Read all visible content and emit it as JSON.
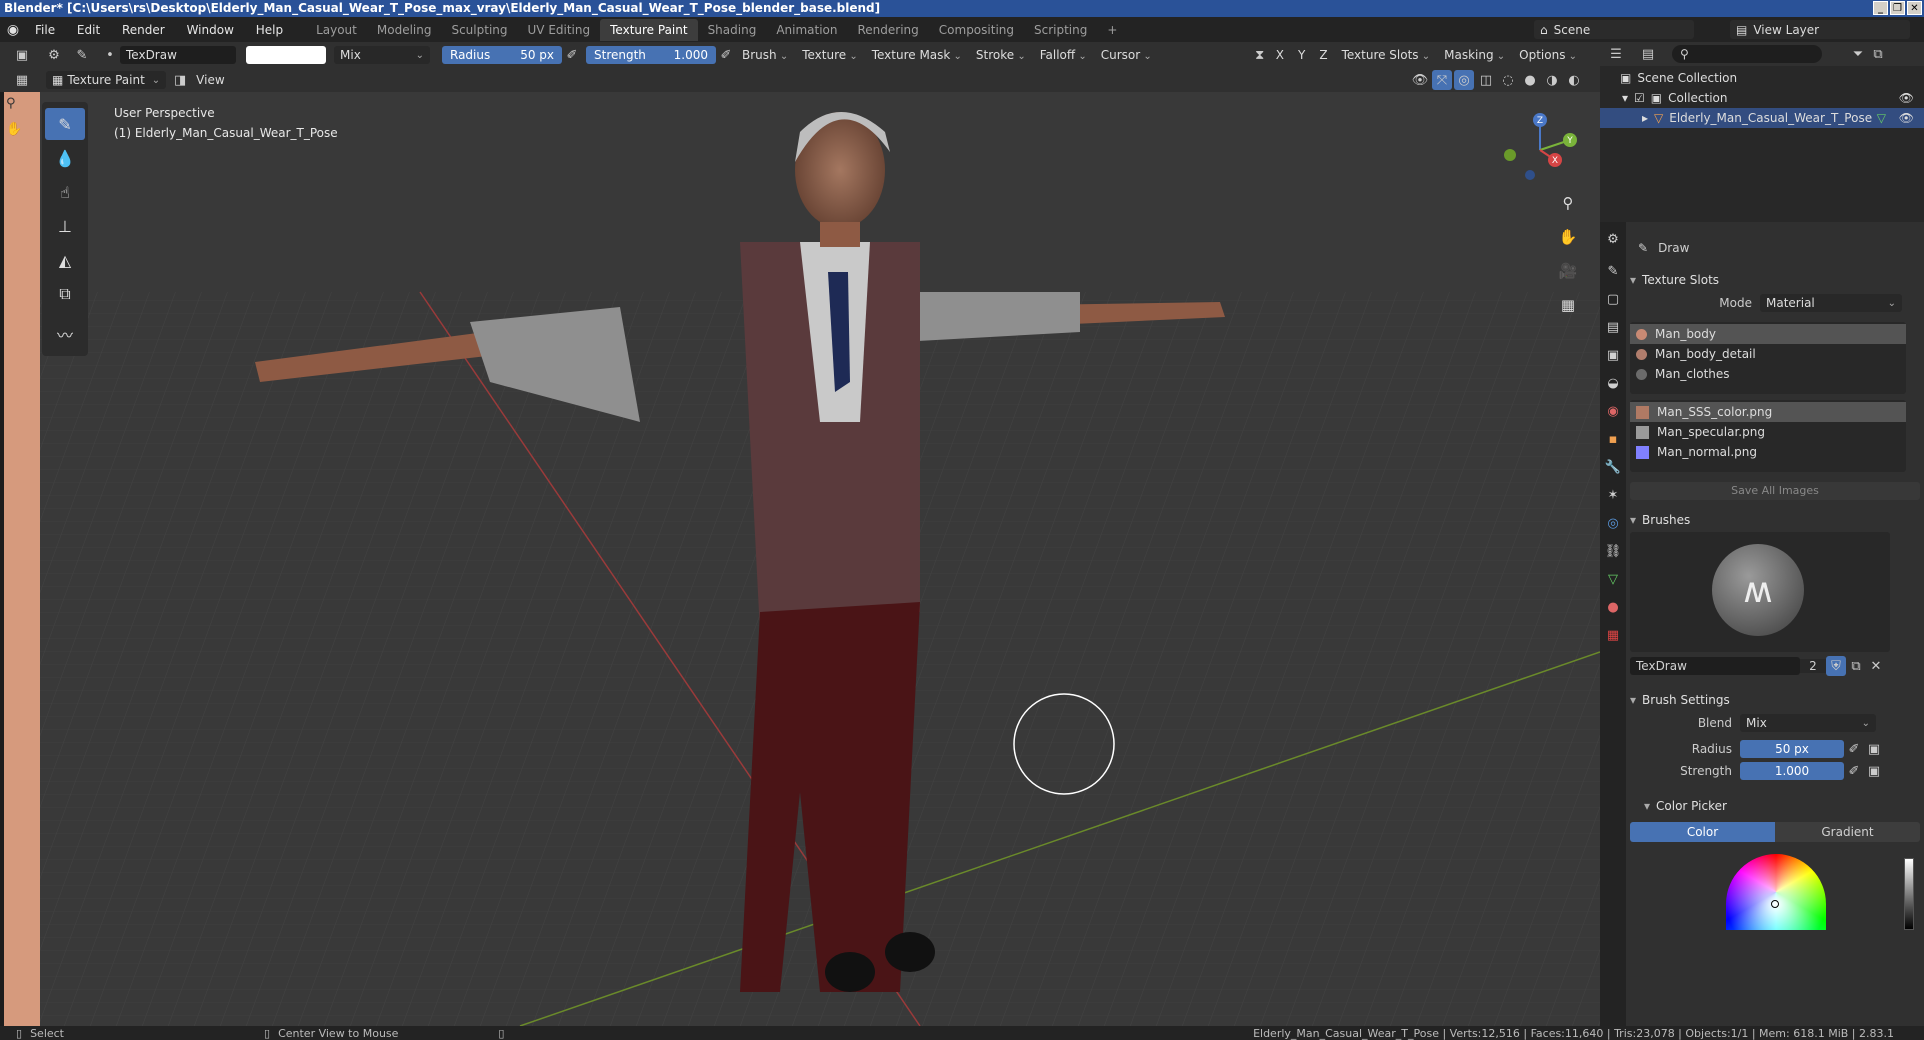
{
  "window": {
    "title": "Blender* [C:\\Users\\rs\\Desktop\\Elderly_Man_Casual_Wear_T_Pose_max_vray\\Elderly_Man_Casual_Wear_T_Pose_blender_base.blend]"
  },
  "menu": [
    "File",
    "Edit",
    "Render",
    "Window",
    "Help"
  ],
  "workspaces": [
    "Layout",
    "Modeling",
    "Sculpting",
    "UV Editing",
    "Texture Paint",
    "Shading",
    "Animation",
    "Rendering",
    "Compositing",
    "Scripting",
    "+"
  ],
  "scene": {
    "name": "Scene",
    "view_layer": "View Layer"
  },
  "tool_header": {
    "brush_name": "TexDraw",
    "blend": "Mix",
    "radius_label": "Radius",
    "radius_value": "50 px",
    "strength_label": "Strength",
    "strength_value": "1.000",
    "menus": [
      "Brush",
      "Texture",
      "Texture Mask",
      "Stroke",
      "Falloff",
      "Cursor"
    ],
    "axes": [
      "X",
      "Y",
      "Z"
    ],
    "right_menus": [
      "Texture Slots",
      "Masking",
      "Options"
    ]
  },
  "view_header": {
    "mode": "Texture Paint",
    "view": "View"
  },
  "viewport": {
    "perspective": "User Perspective",
    "object": "(1) Elderly_Man_Casual_Wear_T_Pose",
    "gizmo": {
      "x": "X",
      "y": "Y",
      "z": "Z"
    }
  },
  "outliner": {
    "items": [
      {
        "label": "Scene Collection"
      },
      {
        "label": "Collection"
      },
      {
        "label": "Elderly_Man_Casual_Wear_T_Pose"
      }
    ]
  },
  "properties": {
    "tool_name": "Draw",
    "texture_slots": {
      "title": "Texture Slots",
      "mode_label": "Mode",
      "mode_value": "Material",
      "materials": [
        {
          "name": "Man_body",
          "color": "#c98a74"
        },
        {
          "name": "Man_body_detail",
          "color": "#b07d6c"
        },
        {
          "name": "Man_clothes",
          "color": "#6b6b6b"
        }
      ],
      "images": [
        {
          "name": "Man_SSS_color.png",
          "color": "#b07a64"
        },
        {
          "name": "Man_specular.png",
          "color": "#9a9a9a"
        },
        {
          "name": "Man_normal.png",
          "color": "#8080ff"
        }
      ],
      "save_all": "Save All Images"
    },
    "brushes": {
      "title": "Brushes",
      "name": "TexDraw",
      "users": "2"
    },
    "brush_settings": {
      "title": "Brush Settings",
      "blend_label": "Blend",
      "blend_value": "Mix",
      "radius_label": "Radius",
      "radius_value": "50 px",
      "strength_label": "Strength",
      "strength_value": "1.000"
    },
    "color_picker": {
      "title": "Color Picker",
      "tabs": [
        "Color",
        "Gradient"
      ]
    }
  },
  "statusbar": {
    "select": "Select",
    "center": "Center View to Mouse",
    "stats": "Elderly_Man_Casual_Wear_T_Pose | Verts:12,516 | Faces:11,640 | Tris:23,078 | Objects:1/1 | Mem: 618.1 MiB | 2.83.1"
  },
  "colors": {
    "accent": "#4772b3",
    "selection": "#334d80",
    "background": "#393939"
  }
}
